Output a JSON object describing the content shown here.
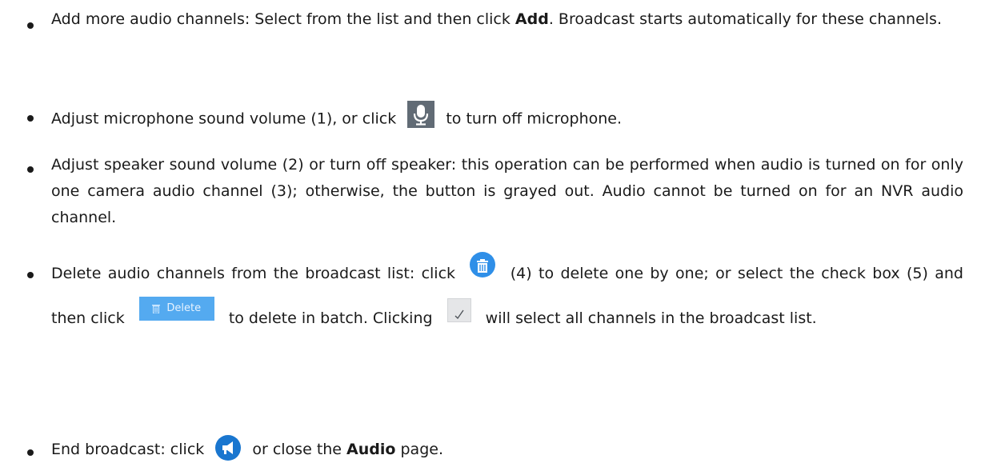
{
  "bullets": [
    {
      "pre": "Add more audio channels: Select from the list and then click ",
      "bold": "Add",
      "post": ". Broadcast starts automatically for these channels."
    },
    {
      "pre": "Adjust microphone sound volume (1), or click",
      "post": "to turn off microphone."
    },
    {
      "text": "Adjust speaker sound volume (2) or turn off speaker: this operation can be performed when audio is turned on for only one camera audio channel (3); otherwise, the button is grayed out. Audio cannot be turned on for an NVR audio channel."
    },
    {
      "pre": "Delete audio channels from the broadcast list: click",
      "mid1": "(4) to delete one by one; or select the check box (5) and then click",
      "mid2": "to delete in batch. Clicking",
      "post": "will select all channels in the broadcast list.",
      "delete_label": "Delete"
    },
    {
      "pre": "End broadcast: click",
      "mid": "or close the ",
      "bold": "Audio",
      "post": " page."
    }
  ],
  "icons": {
    "microphone": "microphone-icon",
    "trash": "trash-icon",
    "delete_button": "delete-button",
    "select_all": "check-icon",
    "broadcast": "broadcast-icon"
  },
  "colors": {
    "text": "#1a1a1a",
    "mic_bg": "#616b75",
    "trash_bg": "#2f8fe8",
    "delete_btn_bg": "#54aaf0",
    "broadcast_bg": "#1976cf"
  }
}
